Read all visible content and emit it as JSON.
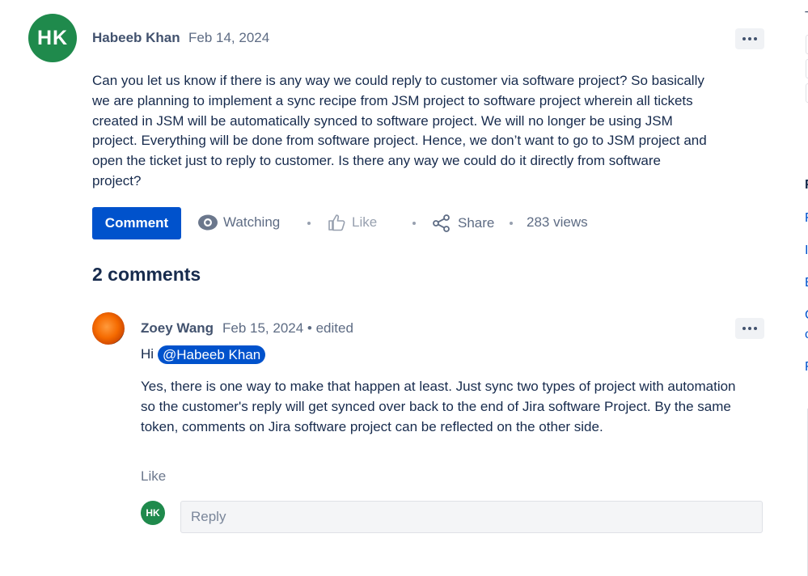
{
  "post": {
    "avatar_initials": "HK",
    "author": "Habeeb Khan",
    "date": "Feb 14, 2024",
    "body": "Can you let us know if there is any way we could reply to customer via software project? So basically we are planning to implement a sync recipe from JSM project to software project wherein all tickets created in JSM will be automatically synced to software project. We will no longer be using JSM project. Everything will be done from software project. Hence, we don’t want to go to JSM project and open the ticket just to reply to customer. Is there any way we could do it directly from software project?"
  },
  "actions": {
    "comment_label": "Comment",
    "watching_label": "Watching",
    "like_label": "Like",
    "share_label": "Share",
    "views_label": "283 views"
  },
  "comments": {
    "heading": "2 comments",
    "items": [
      {
        "author": "Zoey Wang",
        "date": "Feb 15, 2024 • edited",
        "greeting": "Hi",
        "mention": "@Habeeb Khan",
        "body": "Yes, there is one way to make that happen at least. Just sync two types of project with automation so the customer's reply will get synced over back to the end of Jira software Project. By the same token, comments on Jira software project can be reflected on the other side.",
        "like_label": "Like"
      }
    ]
  },
  "reply": {
    "avatar_initials": "HK",
    "placeholder": "Reply"
  },
  "sidebar": {
    "letters": [
      "T",
      "F",
      "F",
      "I",
      "E",
      "C",
      "c",
      "F"
    ]
  },
  "colors": {
    "primary": "#0052cc",
    "avatar_green": "#1f8a4c",
    "text": "#172b4d",
    "muted": "#5e6c84"
  }
}
